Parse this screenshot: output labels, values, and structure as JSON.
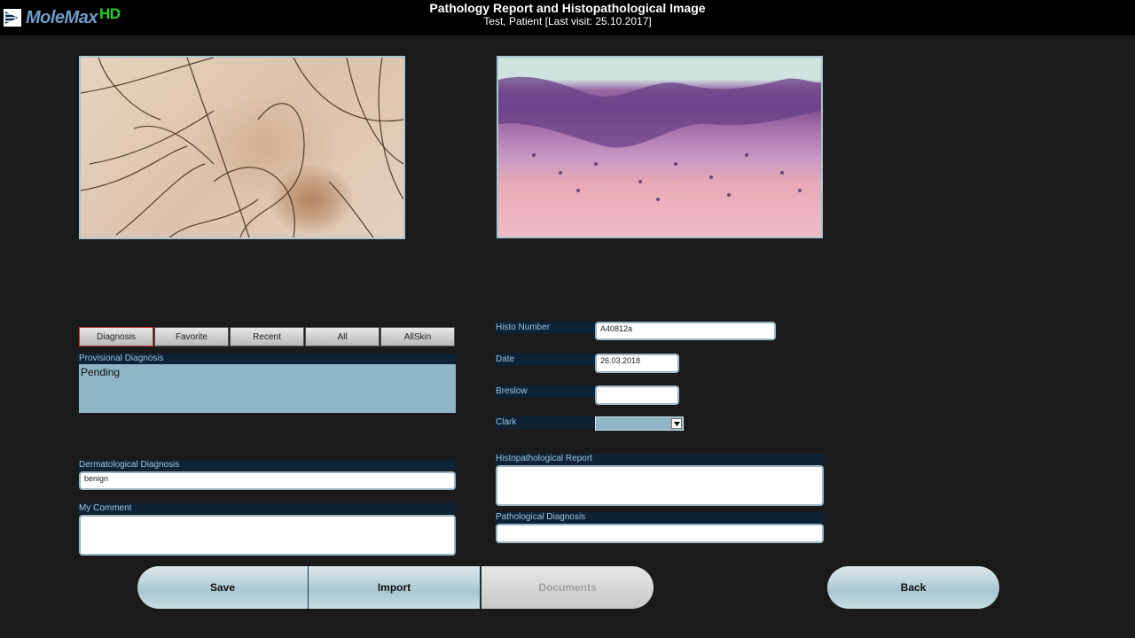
{
  "app": {
    "logo_text": "MoleMax",
    "logo_suffix": "HD"
  },
  "header": {
    "title": "Pathology Report and Histopathological Image",
    "subtitle": "Test, Patient [Last visit: 25.10.2017]"
  },
  "tabs": [
    {
      "label": "Diagnosis",
      "active": true
    },
    {
      "label": "Favorite",
      "active": false
    },
    {
      "label": "Recent",
      "active": false
    },
    {
      "label": "All",
      "active": false
    },
    {
      "label": "AllSkin",
      "active": false
    }
  ],
  "left": {
    "provisional_label": "Provisional Diagnosis",
    "provisional_value": "Pending",
    "dermatological_label": "Dermatological Diagnosis",
    "dermatological_value": "benign",
    "comment_label": "My Comment",
    "comment_value": ""
  },
  "right": {
    "histo_number_label": "Histo Number",
    "histo_number_value": "A40812a",
    "date_label": "Date",
    "date_value": "26.03.2018",
    "breslow_label": "Breslow",
    "breslow_value": "",
    "clark_label": "Clark",
    "clark_value": "",
    "histo_report_label": "Histopathological Report",
    "histo_report_value": "",
    "pathological_label": "Pathological Diagnosis",
    "pathological_value": ""
  },
  "buttons": {
    "save": "Save",
    "import": "Import",
    "documents": "Documents",
    "back": "Back"
  },
  "colors": {
    "background": "#1a1a1a",
    "label_bar": "#0e2236",
    "provisional_bg": "#8fb6c4",
    "logo_hd": "#22d21e"
  }
}
